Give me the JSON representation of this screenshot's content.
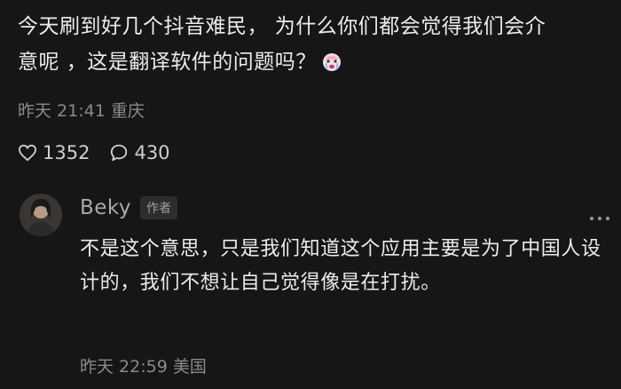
{
  "comment": {
    "text": "今天刷到好几个抖音难民， 为什么你们都会觉得我们会介意呢 ，这是翻译软件的问题吗？",
    "emoji": "crying-face-emoji",
    "time": "昨天 21:41",
    "location": "重庆",
    "likes": "1352",
    "replies": "430"
  },
  "reply": {
    "author": "Beky",
    "badge": "作者",
    "text": "不是这个意思，只是我们知道这个应用主要是为了中国人设计的，我们不想让自己觉得像是在打扰。",
    "time": "昨天 22:59",
    "location": "美国"
  },
  "icons": {
    "like": "heart-icon",
    "comment": "speech-bubble-icon",
    "more": "more-dots-icon"
  },
  "colors": {
    "background": "#161616",
    "text": "#ececec",
    "muted": "#8a8a8a"
  }
}
